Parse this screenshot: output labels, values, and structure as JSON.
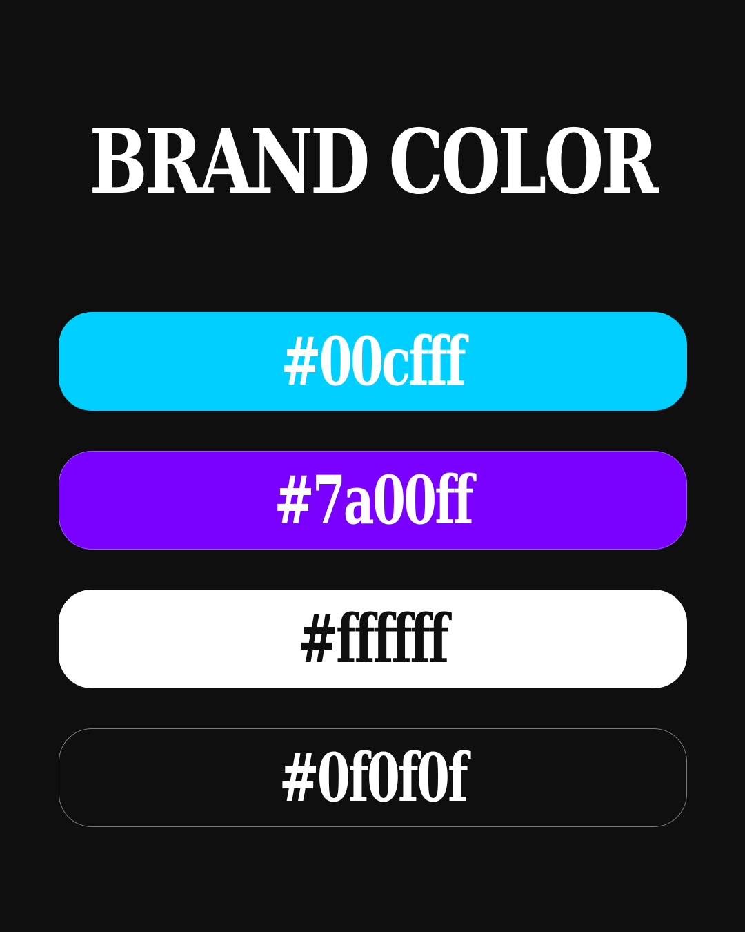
{
  "title": "BRAND COLOR",
  "swatches": [
    {
      "label": "#00cfff",
      "color": "#00cfff",
      "text_color": "#ffffff",
      "border_color": "#00cfff"
    },
    {
      "label": "#7a00ff",
      "color": "#7a00ff",
      "text_color": "#ffffff",
      "border_color": "#9a55ff"
    },
    {
      "label": "#ffffff",
      "color": "#ffffff",
      "text_color": "#0f0f0f",
      "border_color": "#ffffff"
    },
    {
      "label": "#0f0f0f",
      "color": "#0f0f0f",
      "text_color": "#ffffff",
      "border_color": "#7a7a7a"
    }
  ]
}
